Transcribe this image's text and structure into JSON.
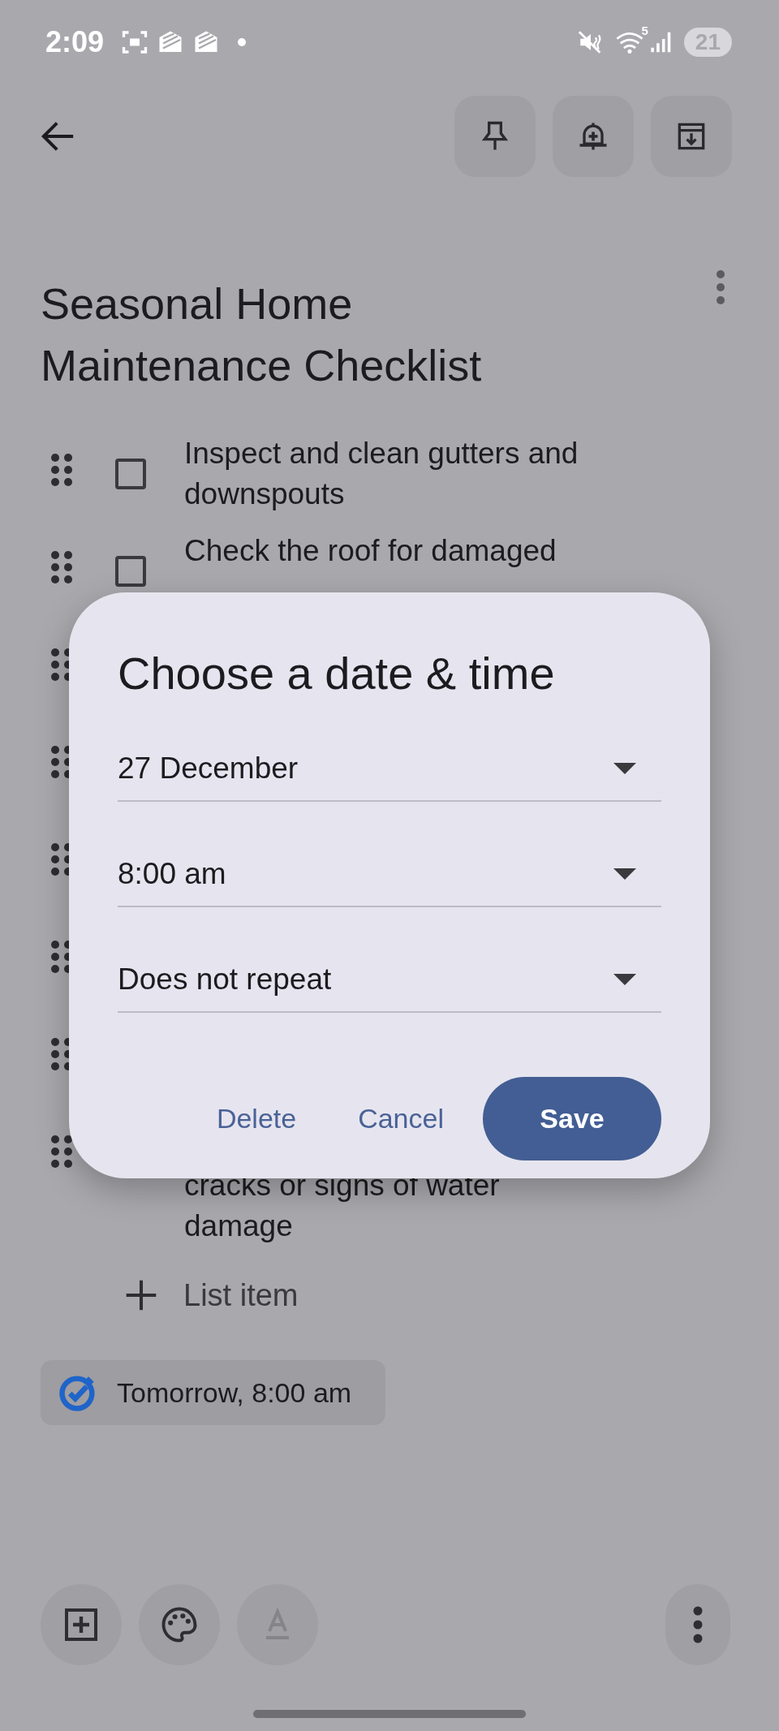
{
  "status_bar": {
    "time": "2:09",
    "wifi_label": "5",
    "battery": "21"
  },
  "note": {
    "title": "Seasonal Home Maintenance Checklist",
    "items": [
      {
        "kind": "full",
        "text": "Inspect and clean gutters and downspouts",
        "checked": false
      },
      {
        "kind": "full",
        "text": "Check the roof for damaged",
        "checked": false
      },
      {
        "kind": "covered"
      },
      {
        "kind": "covered"
      },
      {
        "kind": "covered"
      },
      {
        "kind": "covered"
      },
      {
        "kind": "covered"
      },
      {
        "kind": "tail",
        "text": "cracks or signs of water damage"
      }
    ],
    "add_item": {
      "label": "List item"
    }
  },
  "reminder": {
    "label": "Tomorrow, 8:00 am"
  },
  "dialog": {
    "title": "Choose a date & time",
    "fields": [
      {
        "value": "27 December"
      },
      {
        "value": "8:00 am"
      },
      {
        "value": "Does not repeat"
      }
    ],
    "buttons": [
      {
        "label": "Delete",
        "kind": "text"
      },
      {
        "label": "Cancel",
        "kind": "text"
      },
      {
        "label": "Save",
        "kind": "filled"
      }
    ]
  },
  "bottom_bar": {
    "text_format_disabled": true
  }
}
